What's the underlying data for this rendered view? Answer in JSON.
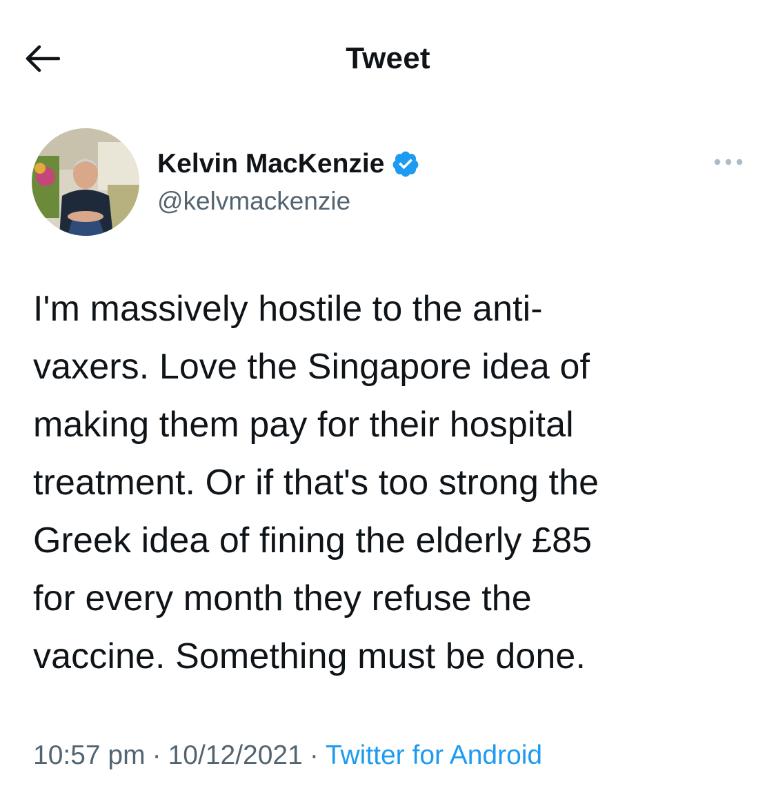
{
  "header": {
    "title": "Tweet",
    "back_icon": "arrow-left-icon"
  },
  "author": {
    "display_name": "Kelvin MacKenzie",
    "handle": "@kelvmackenzie",
    "verified_icon": "verified-badge-icon",
    "verified_color": "#1d9bf0",
    "more_icon": "more-horizontal-icon"
  },
  "tweet": {
    "text": "I'm massively hostile to the anti-\nvaxers. Love the Singapore idea of\nmaking them pay for their hospital\ntreatment. Or if that's too strong the\nGreek idea of fining the elderly £85\nfor every month they refuse the\nvaccine. Something must be done."
  },
  "meta": {
    "time": "10:57 pm",
    "date": "10/12/2021",
    "separator": "·",
    "source": "Twitter for Android",
    "source_color": "#1d9bf0"
  }
}
